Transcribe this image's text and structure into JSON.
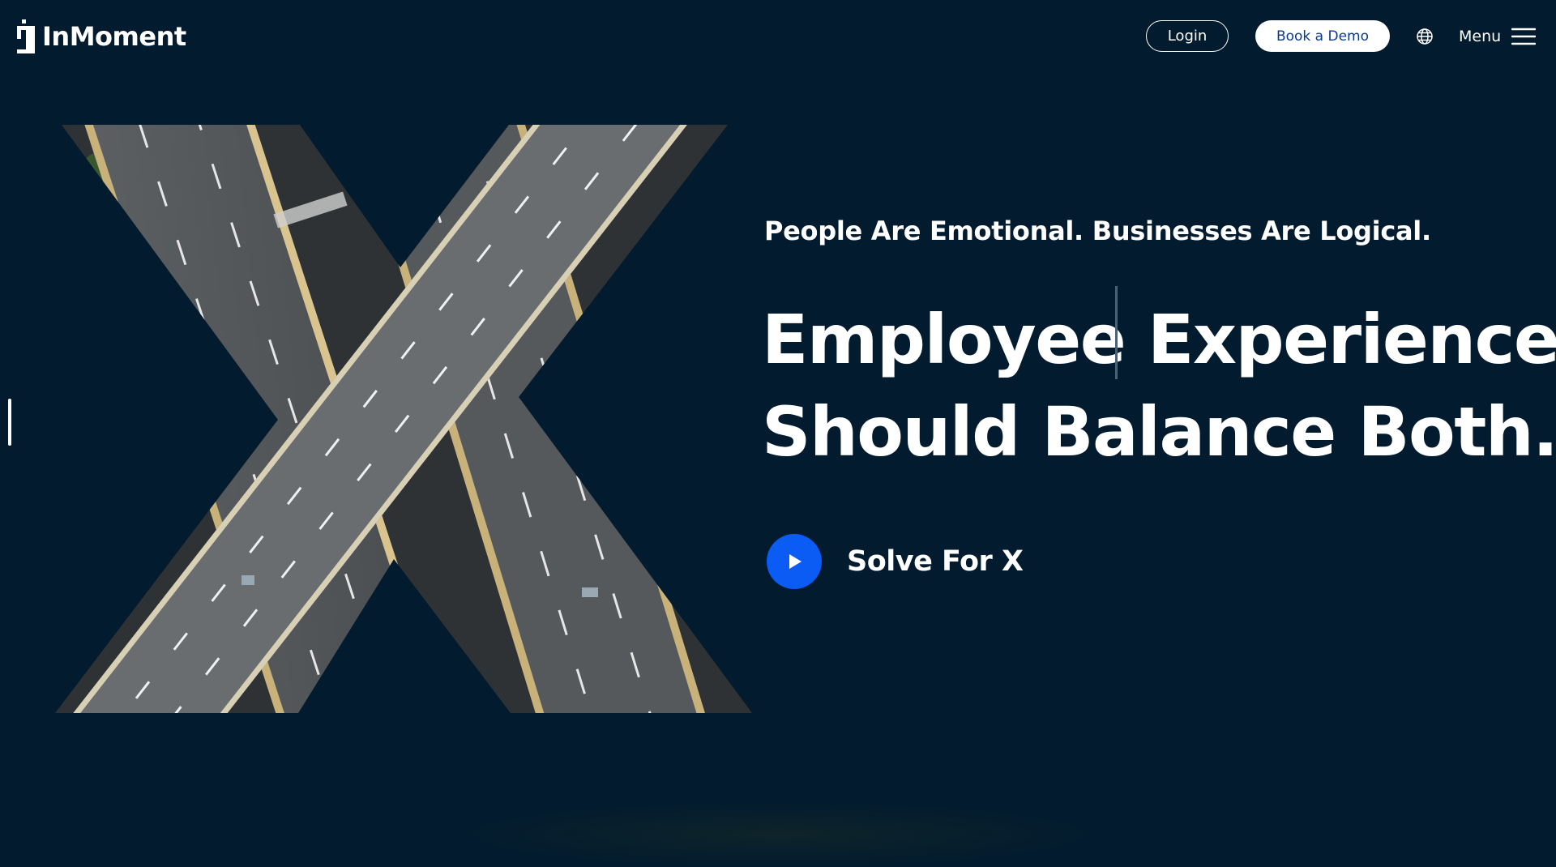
{
  "header": {
    "brand": "InMoment",
    "login_label": "Login",
    "demo_label": "Book a Demo",
    "menu_label": "Menu",
    "globe_icon": "globe-icon",
    "menu_icon": "hamburger-icon"
  },
  "hero": {
    "eyebrow": "People Are Emotional. Businesses Are Logical.",
    "headline_line1": "Employee Experience",
    "headline_line2": "Should Balance Both.",
    "cta_label": "Solve For X",
    "cta_icon": "play-icon",
    "graphic": "x-shaped-highway-image"
  },
  "colors": {
    "background": "#021b2e",
    "accent": "#0a5cf5",
    "text": "#ffffff",
    "demo_text": "#0b3a8a"
  }
}
